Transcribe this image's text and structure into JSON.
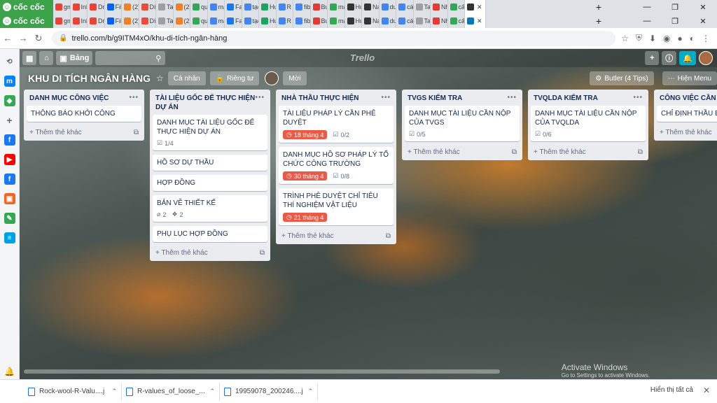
{
  "browser": {
    "brand": "cốc cốc",
    "tab_rows": [
      {
        "tabs": [
          {
            "label": "gm",
            "color": "#ea4335"
          },
          {
            "label": "Inb",
            "color": "#ea4335"
          },
          {
            "label": "Dr",
            "color": "#ea4335"
          },
          {
            "label": "File",
            "color": "#0061ff"
          },
          {
            "label": "(2)",
            "color": "#f48024"
          },
          {
            "label": "Dír",
            "color": "#e74c3c"
          },
          {
            "label": "Tab m",
            "color": "#9aa0a6"
          },
          {
            "label": "(2)",
            "color": "#f48024"
          },
          {
            "label": "qu",
            "color": "#34a853"
          },
          {
            "label": "má",
            "color": "#4285f4"
          },
          {
            "label": "Fac",
            "color": "#1877f2"
          },
          {
            "label": "tạo",
            "color": "#4285f4"
          },
          {
            "label": "Hư",
            "color": "#1da462"
          },
          {
            "label": "R V",
            "color": "#4285f4"
          },
          {
            "label": "fib",
            "color": "#4285f4"
          },
          {
            "label": "Bui",
            "color": "#e53935"
          },
          {
            "label": "má",
            "color": "#34a853"
          },
          {
            "label": "Hư",
            "color": "#333333"
          },
          {
            "label": "Na",
            "color": "#333333"
          },
          {
            "label": "dư",
            "color": "#4285f4"
          },
          {
            "label": "các",
            "color": "#4285f4"
          },
          {
            "label": "Tab m",
            "color": "#9aa0a6"
          },
          {
            "label": "Nh",
            "color": "#e53935"
          },
          {
            "label": "cấu",
            "color": "#34a853"
          },
          {
            "label": "",
            "color": "#333333",
            "active": true
          }
        ]
      },
      {
        "tabs": [
          {
            "label": "gm",
            "color": "#ea4335"
          },
          {
            "label": "Inb",
            "color": "#ea4335"
          },
          {
            "label": "Dr",
            "color": "#ea4335"
          },
          {
            "label": "File",
            "color": "#0061ff"
          },
          {
            "label": "(2)",
            "color": "#f48024"
          },
          {
            "label": "Dír",
            "color": "#e74c3c"
          },
          {
            "label": "Tab m",
            "color": "#9aa0a6"
          },
          {
            "label": "(2)",
            "color": "#f48024"
          },
          {
            "label": "qu",
            "color": "#34a853"
          },
          {
            "label": "má",
            "color": "#4285f4"
          },
          {
            "label": "Fac",
            "color": "#1877f2"
          },
          {
            "label": "tạo",
            "color": "#4285f4"
          },
          {
            "label": "Hư",
            "color": "#1da462"
          },
          {
            "label": "R V",
            "color": "#4285f4"
          },
          {
            "label": "fib",
            "color": "#4285f4"
          },
          {
            "label": "Bui",
            "color": "#e53935"
          },
          {
            "label": "má",
            "color": "#34a853"
          },
          {
            "label": "Hư",
            "color": "#333333"
          },
          {
            "label": "Na",
            "color": "#333333"
          },
          {
            "label": "dư",
            "color": "#4285f4"
          },
          {
            "label": "các",
            "color": "#4285f4"
          },
          {
            "label": "Tab m",
            "color": "#9aa0a6"
          },
          {
            "label": "Nh",
            "color": "#e53935"
          },
          {
            "label": "cấu",
            "color": "#34a853"
          },
          {
            "label": "",
            "color": "#0079bf",
            "active": true
          }
        ]
      }
    ],
    "url": "trello.com/b/g9ITM4xO/khu-di-tích-ngân-hàng"
  },
  "trello": {
    "boards_button": "Bảng",
    "logo": "Trello",
    "board_title": "KHU DI TÍCH NGÂN HÀNG",
    "visibility_team": "Cá nhân",
    "visibility_private": "Riêng tư",
    "invite": "Mời",
    "butler": "Butler (4 Tips)",
    "show_menu": "Hiện Menu",
    "add_card_label": "Thêm thẻ khác",
    "lists": [
      {
        "title": "DANH MỤC CÔNG VIỆC",
        "cards": [
          {
            "text": "THÔNG BÁO KHỞI CÔNG"
          }
        ]
      },
      {
        "title": "TÀI LIỆU GỐC ĐỂ THỰC HIỆN DỰ ÁN",
        "cards": [
          {
            "text": "DANH MỤC TÀI LIỆU GỐC ĐỂ THỰC HIỆN DỰ ÁN",
            "checklist": "1/4"
          },
          {
            "text": "HỒ SƠ DỰ THẦU"
          },
          {
            "text": "HỢP ĐỒNG"
          },
          {
            "text": "BẢN VẼ THIẾT KẾ",
            "attachments": "2",
            "dropbox": "2"
          },
          {
            "text": "PHỤ LỤC HỢP ĐỒNG"
          }
        ]
      },
      {
        "title": "NHÀ THẦU THỰC HIỆN",
        "cards": [
          {
            "text": "TÀI LIỆU PHÁP LÝ CẦN PHÊ DUYỆT",
            "due": "18 tháng 4",
            "checklist": "0/2"
          },
          {
            "text": "DANH MỤC HỒ SƠ PHÁP LÝ TỔ CHỨC CÔNG TRƯỜNG",
            "due": "30 tháng 4",
            "checklist": "0/8"
          },
          {
            "text": "TRÌNH PHÊ DUYỆT CHỈ TIÊU THÍ NGHIỆM VẬT LIỆU",
            "due": "21 tháng 4"
          }
        ]
      },
      {
        "title": "TVGS KIỂM TRA",
        "cards": [
          {
            "text": "DANH MỤC TÀI LIỆU CẦN NỘP CỦA TVGS",
            "checklist": "0/5"
          }
        ]
      },
      {
        "title": "TVQLDA KIỂM TRA",
        "cards": [
          {
            "text": "DANH MỤC TÀI LIỆU CẦN NỘP CỦA TVQLDA",
            "checklist": "0/6"
          }
        ]
      },
      {
        "title": "CÔNG VIỆC CẦN PHÊ",
        "cards": [
          {
            "text": "CHỈ ĐỊNH THẦU BẢO"
          }
        ]
      }
    ]
  },
  "watermark": {
    "title": "Activate Windows",
    "subtitle": "Go to Settings to activate Windows."
  },
  "downloads": {
    "items": [
      {
        "name": "Rock-wool-R-Valu....j"
      },
      {
        "name": "R-values_of_loose_....j"
      },
      {
        "name": "19959078_200246....j"
      }
    ],
    "show_all": "Hiển thị tất cả"
  }
}
